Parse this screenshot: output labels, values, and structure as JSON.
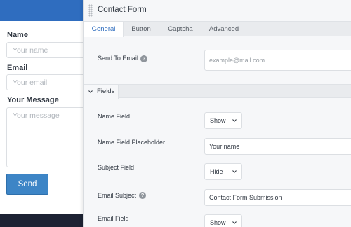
{
  "preview": {
    "name_label": "Name",
    "name_placeholder": "Your name",
    "email_label": "Email",
    "email_placeholder": "Your email",
    "message_label": "Your Message",
    "message_placeholder": "Your message",
    "send_label": "Send"
  },
  "panel": {
    "title": "Contact Form",
    "tabs": [
      {
        "label": "General",
        "active": true
      },
      {
        "label": "Button",
        "active": false
      },
      {
        "label": "Captcha",
        "active": false
      },
      {
        "label": "Advanced",
        "active": false
      }
    ],
    "send_to_email": {
      "label": "Send To Email",
      "placeholder": "example@mail.com"
    },
    "fields_section": {
      "label": "Fields",
      "expanded": true
    },
    "name_field": {
      "label": "Name Field",
      "value": "Show"
    },
    "name_field_placeholder": {
      "label": "Name Field Placeholder",
      "value": "Your name"
    },
    "subject_field": {
      "label": "Subject Field",
      "value": "Hide"
    },
    "email_subject": {
      "label": "Email Subject",
      "value": "Contact Form Submission"
    },
    "email_field": {
      "label": "Email Field",
      "value": "Show"
    }
  },
  "colors": {
    "accent": "#2f6dbf",
    "send_button": "#3d85c6",
    "footer": "#1d2233"
  },
  "icons": [
    "help-icon",
    "chevron-down-icon",
    "drag-handle-icon"
  ]
}
